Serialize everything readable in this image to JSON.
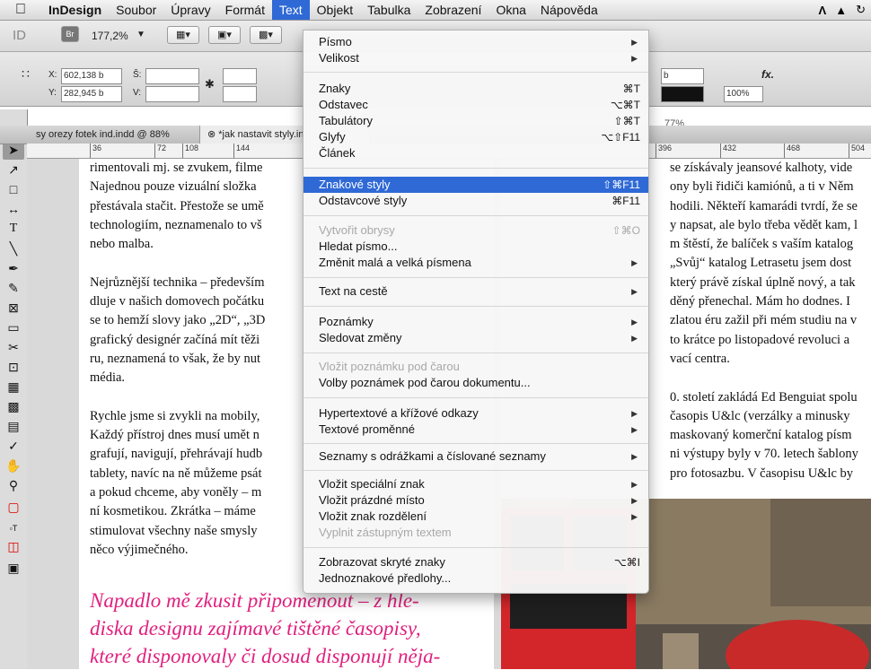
{
  "menubar": {
    "app": "InDesign",
    "items": [
      "Soubor",
      "Úpravy",
      "Formát",
      "Text",
      "Objekt",
      "Tabulka",
      "Zobrazení",
      "Okna",
      "Nápověda"
    ],
    "active": "Text"
  },
  "control": {
    "zoom": "177,2%",
    "br": "Br",
    "x_label": "X:",
    "x_value": "602,138 b",
    "y_label": "Y:",
    "y_value": "282,945 b",
    "w_label": "Š:",
    "h_label": "V:",
    "right_b": "b",
    "pct": "100%",
    "pct2": "77%",
    "fx": "fx."
  },
  "tabs": {
    "first": "sy orezy fotek ind.indd @ 88%",
    "second": "*jak nastavit styly.in"
  },
  "ruler": [
    "36",
    "72",
    "108",
    "144",
    "396",
    "432",
    "468",
    "504"
  ],
  "menu": {
    "items": [
      {
        "label": "Písmo",
        "sub": true
      },
      {
        "label": "Velikost",
        "sub": true
      },
      {
        "label": "Znaky",
        "key": "⌘T"
      },
      {
        "label": "Odstavec",
        "key": "⌥⌘T"
      },
      {
        "label": "Tabulátory",
        "key": "⇧⌘T"
      },
      {
        "label": "Glyfy",
        "key": "⌥⇧F11"
      },
      {
        "label": "Článek"
      },
      {
        "label": "Znakové styly",
        "key": "⇧⌘F11",
        "highlight": true
      },
      {
        "label": "Odstavcové styly",
        "key": "⌘F11"
      },
      {
        "label": "Vytvořit obrysy",
        "key": "⇧⌘O",
        "disabled": true
      },
      {
        "label": "Hledat písmo..."
      },
      {
        "label": "Změnit malá a velká písmena",
        "sub": true
      },
      {
        "label": "Text na cestě",
        "sub": true
      },
      {
        "label": "Poznámky",
        "sub": true
      },
      {
        "label": "Sledovat změny",
        "sub": true
      },
      {
        "label": "Vložit poznámku pod čarou",
        "disabled": true
      },
      {
        "label": "Volby poznámek pod čarou dokumentu..."
      },
      {
        "label": "Hypertextové a křížové odkazy",
        "sub": true
      },
      {
        "label": "Textové proměnné",
        "sub": true
      },
      {
        "label": "Seznamy s odrážkami a číslované seznamy",
        "sub": true
      },
      {
        "label": "Vložit speciální znak",
        "sub": true
      },
      {
        "label": "Vložit prázdné místo",
        "sub": true
      },
      {
        "label": "Vložit znak rozdělení",
        "sub": true
      },
      {
        "label": "Vyplnit zástupným textem",
        "disabled": true
      },
      {
        "label": "Zobrazovat skryté znaky",
        "key": "⌥⌘I"
      },
      {
        "label": "Jednoznakové předlohy..."
      }
    ]
  },
  "left_text": {
    "p1": [
      "rimentovali mj. se zvukem, filme",
      "Najednou pouze vizuální složka",
      "přestávala stačit. Přestože se umě",
      "technologiím, neznamenalo to vš",
      "nebo malba."
    ],
    "p2": [
      "Nejrůznější technika – především",
      "dluje v našich domovech počátku",
      "se to hemží slovy jako „2D“, „3D",
      "grafický designér začíná mít těži",
      "ru, neznamená to však, že by nut",
      "média."
    ],
    "p3": [
      "Rychle jsme si zvykli na mobily,",
      "Každý přístroj dnes musí umět n",
      "grafují, navigují, přehrávají hudb",
      "tablety, navíc na ně můžeme psát",
      "a pokud chceme, aby voněly – m",
      "ní kosmetikou. Zkrátka – máme",
      "stimulovat všechny naše smysly",
      "něco výjimečného."
    ],
    "pull": [
      "Napadlo mě zkusit připomenout – z hle-",
      "diska designu zajímavé tištěné časopisy,",
      "které disponovaly či dosud disponují něja-"
    ]
  },
  "right_text": {
    "p1": [
      "se získávaly jeansové kalhoty, vide",
      "ony byli řidiči kamiónů, a ti v Něm",
      "hodili. Někteří kamarádi tvrdí, že se",
      "y napsat, ale bylo třeba vědět kam, l",
      "m štěstí, že balíček s vaším katalog",
      "„Svůj“ katalog Letrasetu jsem dost",
      "který právě získal úplně nový, a tak",
      "děný přenechal. Mám ho dodnes. I",
      "zlatou éru zažil při mém studiu na v",
      "to krátce po listopadové revoluci a",
      "vací centra."
    ],
    "p2": [
      "0. století zakládá Ed Benguiat spolu",
      "časopis U&lc (verzálky a minusky",
      "maskovaný komerční katalog písm",
      "ni výstupy byly v 70. letech šablony",
      "pro fotosazbu. V časopisu U&lc by"
    ]
  }
}
